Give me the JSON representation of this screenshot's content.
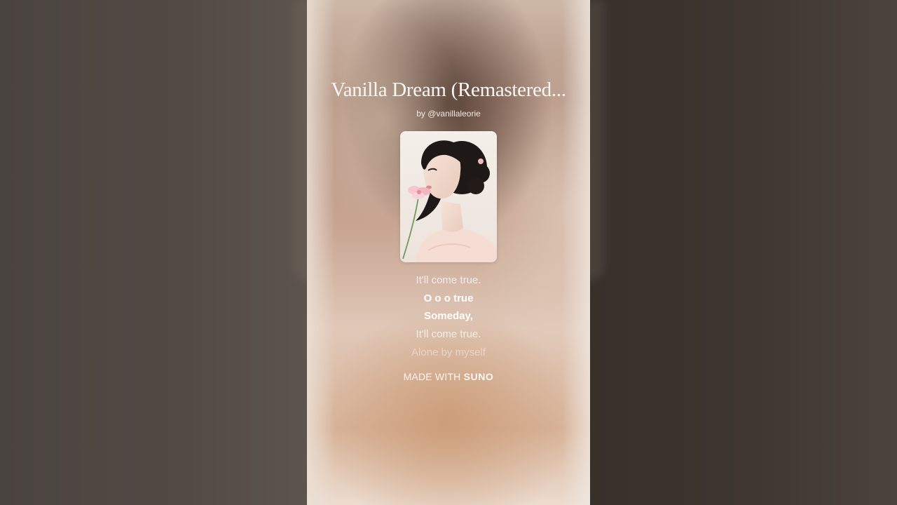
{
  "song": {
    "title": "Vanilla Dream (Remastered...",
    "byline": "by @vanillaleorie"
  },
  "lyrics": [
    {
      "text": "It'll come true.",
      "style": "normal"
    },
    {
      "text": "O o o true",
      "style": "bold"
    },
    {
      "text": "Someday,",
      "style": "bold"
    },
    {
      "text": "It'll come true.",
      "style": "normal"
    },
    {
      "text": "Alone by myself",
      "style": "faint"
    }
  ],
  "footer": {
    "made_with": "MADE WITH",
    "brand": "SUNO"
  },
  "colors": {
    "text": "#fbf6f2",
    "side_background": "#3a3330"
  }
}
